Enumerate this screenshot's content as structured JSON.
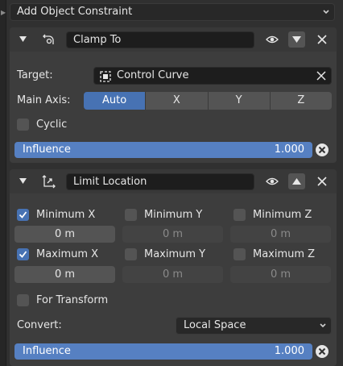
{
  "add_constraint": {
    "label": "Add Object Constraint"
  },
  "clamp": {
    "name": "Clamp To",
    "target_label": "Target:",
    "target_value": "Control Curve",
    "main_axis_label": "Main Axis:",
    "axis_options": [
      "Auto",
      "X",
      "Y",
      "Z"
    ],
    "axis_selected": "Auto",
    "cyclic_label": "Cyclic",
    "cyclic_checked": false,
    "influence_label": "Influence",
    "influence_value": "1.000"
  },
  "limit": {
    "name": "Limit Location",
    "min_x": {
      "label": "Minimum X",
      "checked": true,
      "value": "0 m"
    },
    "min_y": {
      "label": "Minimum Y",
      "checked": false,
      "value": "0 m"
    },
    "min_z": {
      "label": "Minimum Z",
      "checked": false,
      "value": "0 m"
    },
    "max_x": {
      "label": "Maximum X",
      "checked": true,
      "value": "0 m"
    },
    "max_y": {
      "label": "Maximum Y",
      "checked": false,
      "value": "0 m"
    },
    "max_z": {
      "label": "Maximum Z",
      "checked": false,
      "value": "0 m"
    },
    "for_transform_label": "For Transform",
    "for_transform_checked": false,
    "convert_label": "Convert:",
    "convert_value": "Local Space",
    "influence_label": "Influence",
    "influence_value": "1.000"
  },
  "colors": {
    "accent": "#4772b3",
    "influence": "#5680c2",
    "background": "#303030",
    "panel": "#3d3d3d"
  }
}
